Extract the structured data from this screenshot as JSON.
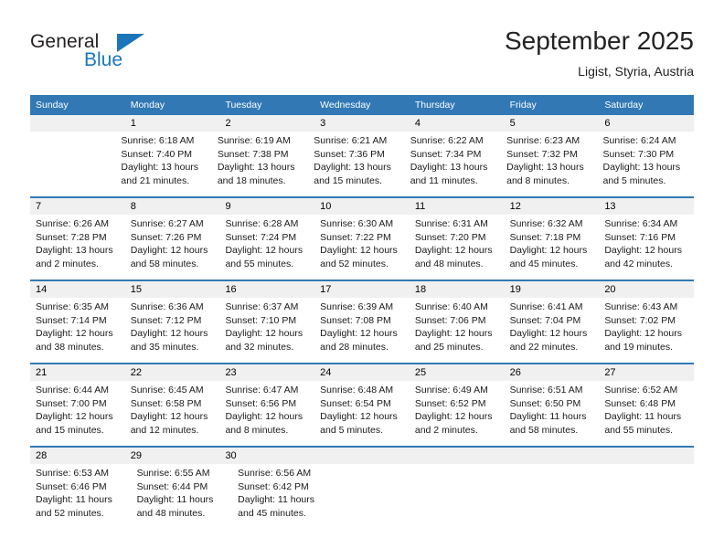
{
  "brand": {
    "name_part1": "General",
    "name_part2": "Blue",
    "accent_color": "#1b75bb"
  },
  "header": {
    "title": "September 2025",
    "subtitle": "Ligist, Styria, Austria"
  },
  "calendar": {
    "header_color": "#3178b5",
    "day_strip_color": "#f0f0f0",
    "weekdays": [
      "Sunday",
      "Monday",
      "Tuesday",
      "Wednesday",
      "Thursday",
      "Friday",
      "Saturday"
    ],
    "weeks": [
      {
        "days": [
          {
            "num": "",
            "lines": []
          },
          {
            "num": "1",
            "lines": [
              "Sunrise: 6:18 AM",
              "Sunset: 7:40 PM",
              "Daylight: 13 hours",
              "and 21 minutes."
            ]
          },
          {
            "num": "2",
            "lines": [
              "Sunrise: 6:19 AM",
              "Sunset: 7:38 PM",
              "Daylight: 13 hours",
              "and 18 minutes."
            ]
          },
          {
            "num": "3",
            "lines": [
              "Sunrise: 6:21 AM",
              "Sunset: 7:36 PM",
              "Daylight: 13 hours",
              "and 15 minutes."
            ]
          },
          {
            "num": "4",
            "lines": [
              "Sunrise: 6:22 AM",
              "Sunset: 7:34 PM",
              "Daylight: 13 hours",
              "and 11 minutes."
            ]
          },
          {
            "num": "5",
            "lines": [
              "Sunrise: 6:23 AM",
              "Sunset: 7:32 PM",
              "Daylight: 13 hours",
              "and 8 minutes."
            ]
          },
          {
            "num": "6",
            "lines": [
              "Sunrise: 6:24 AM",
              "Sunset: 7:30 PM",
              "Daylight: 13 hours",
              "and 5 minutes."
            ]
          }
        ]
      },
      {
        "days": [
          {
            "num": "7",
            "lines": [
              "Sunrise: 6:26 AM",
              "Sunset: 7:28 PM",
              "Daylight: 13 hours",
              "and 2 minutes."
            ]
          },
          {
            "num": "8",
            "lines": [
              "Sunrise: 6:27 AM",
              "Sunset: 7:26 PM",
              "Daylight: 12 hours",
              "and 58 minutes."
            ]
          },
          {
            "num": "9",
            "lines": [
              "Sunrise: 6:28 AM",
              "Sunset: 7:24 PM",
              "Daylight: 12 hours",
              "and 55 minutes."
            ]
          },
          {
            "num": "10",
            "lines": [
              "Sunrise: 6:30 AM",
              "Sunset: 7:22 PM",
              "Daylight: 12 hours",
              "and 52 minutes."
            ]
          },
          {
            "num": "11",
            "lines": [
              "Sunrise: 6:31 AM",
              "Sunset: 7:20 PM",
              "Daylight: 12 hours",
              "and 48 minutes."
            ]
          },
          {
            "num": "12",
            "lines": [
              "Sunrise: 6:32 AM",
              "Sunset: 7:18 PM",
              "Daylight: 12 hours",
              "and 45 minutes."
            ]
          },
          {
            "num": "13",
            "lines": [
              "Sunrise: 6:34 AM",
              "Sunset: 7:16 PM",
              "Daylight: 12 hours",
              "and 42 minutes."
            ]
          }
        ]
      },
      {
        "days": [
          {
            "num": "14",
            "lines": [
              "Sunrise: 6:35 AM",
              "Sunset: 7:14 PM",
              "Daylight: 12 hours",
              "and 38 minutes."
            ]
          },
          {
            "num": "15",
            "lines": [
              "Sunrise: 6:36 AM",
              "Sunset: 7:12 PM",
              "Daylight: 12 hours",
              "and 35 minutes."
            ]
          },
          {
            "num": "16",
            "lines": [
              "Sunrise: 6:37 AM",
              "Sunset: 7:10 PM",
              "Daylight: 12 hours",
              "and 32 minutes."
            ]
          },
          {
            "num": "17",
            "lines": [
              "Sunrise: 6:39 AM",
              "Sunset: 7:08 PM",
              "Daylight: 12 hours",
              "and 28 minutes."
            ]
          },
          {
            "num": "18",
            "lines": [
              "Sunrise: 6:40 AM",
              "Sunset: 7:06 PM",
              "Daylight: 12 hours",
              "and 25 minutes."
            ]
          },
          {
            "num": "19",
            "lines": [
              "Sunrise: 6:41 AM",
              "Sunset: 7:04 PM",
              "Daylight: 12 hours",
              "and 22 minutes."
            ]
          },
          {
            "num": "20",
            "lines": [
              "Sunrise: 6:43 AM",
              "Sunset: 7:02 PM",
              "Daylight: 12 hours",
              "and 19 minutes."
            ]
          }
        ]
      },
      {
        "days": [
          {
            "num": "21",
            "lines": [
              "Sunrise: 6:44 AM",
              "Sunset: 7:00 PM",
              "Daylight: 12 hours",
              "and 15 minutes."
            ]
          },
          {
            "num": "22",
            "lines": [
              "Sunrise: 6:45 AM",
              "Sunset: 6:58 PM",
              "Daylight: 12 hours",
              "and 12 minutes."
            ]
          },
          {
            "num": "23",
            "lines": [
              "Sunrise: 6:47 AM",
              "Sunset: 6:56 PM",
              "Daylight: 12 hours",
              "and 8 minutes."
            ]
          },
          {
            "num": "24",
            "lines": [
              "Sunrise: 6:48 AM",
              "Sunset: 6:54 PM",
              "Daylight: 12 hours",
              "and 5 minutes."
            ]
          },
          {
            "num": "25",
            "lines": [
              "Sunrise: 6:49 AM",
              "Sunset: 6:52 PM",
              "Daylight: 12 hours",
              "and 2 minutes."
            ]
          },
          {
            "num": "26",
            "lines": [
              "Sunrise: 6:51 AM",
              "Sunset: 6:50 PM",
              "Daylight: 11 hours",
              "and 58 minutes."
            ]
          },
          {
            "num": "27",
            "lines": [
              "Sunrise: 6:52 AM",
              "Sunset: 6:48 PM",
              "Daylight: 11 hours",
              "and 55 minutes."
            ]
          }
        ]
      },
      {
        "days": [
          {
            "num": "28",
            "lines": [
              "Sunrise: 6:53 AM",
              "Sunset: 6:46 PM",
              "Daylight: 11 hours",
              "and 52 minutes."
            ]
          },
          {
            "num": "29",
            "lines": [
              "Sunrise: 6:55 AM",
              "Sunset: 6:44 PM",
              "Daylight: 11 hours",
              "and 48 minutes."
            ]
          },
          {
            "num": "30",
            "lines": [
              "Sunrise: 6:56 AM",
              "Sunset: 6:42 PM",
              "Daylight: 11 hours",
              "and 45 minutes."
            ]
          },
          {
            "num": "",
            "lines": []
          },
          {
            "num": "",
            "lines": []
          },
          {
            "num": "",
            "lines": []
          },
          {
            "num": "",
            "lines": []
          }
        ]
      }
    ]
  }
}
